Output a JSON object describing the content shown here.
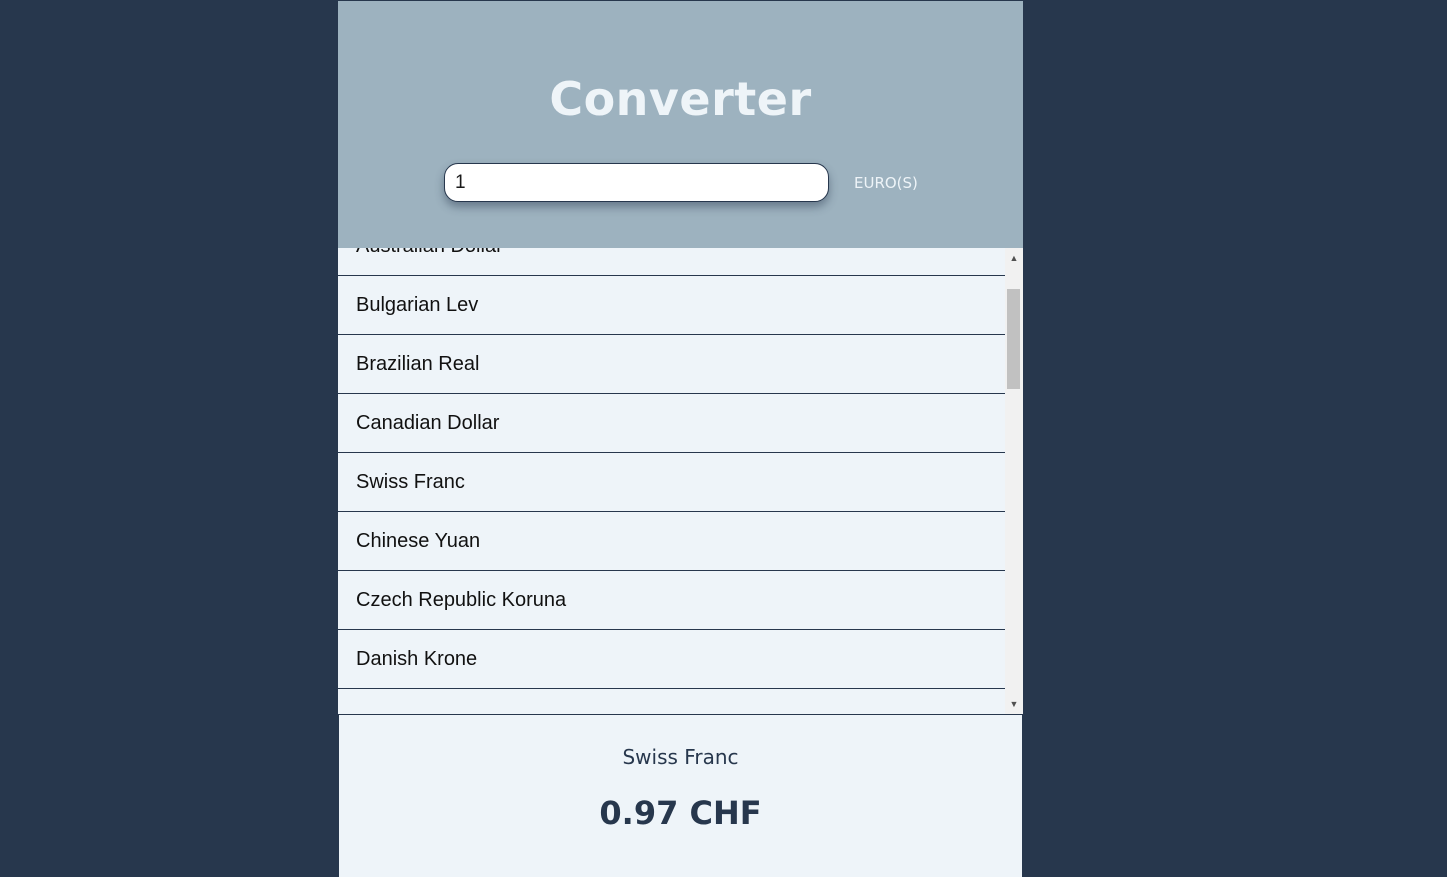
{
  "header": {
    "title": "Converter",
    "amount_value": "1",
    "unit_label": "EURO(S)"
  },
  "currency_list": {
    "items": [
      {
        "label": "Australian Dollar"
      },
      {
        "label": "Bulgarian Lev"
      },
      {
        "label": "Brazilian Real"
      },
      {
        "label": "Canadian Dollar"
      },
      {
        "label": "Swiss Franc"
      },
      {
        "label": "Chinese Yuan"
      },
      {
        "label": "Czech Republic Koruna"
      },
      {
        "label": "Danish Krone"
      }
    ],
    "scroll_up_icon": "triangle-up",
    "scroll_down_icon": "triangle-down"
  },
  "result": {
    "currency_name": "Swiss Franc",
    "converted_amount": "0.97 CHF"
  },
  "colors": {
    "page_background": "#27374d",
    "header_background": "#9db2bf",
    "panel_background": "#eef4f9",
    "header_text": "#eef4f8",
    "result_text": "#27374d"
  }
}
